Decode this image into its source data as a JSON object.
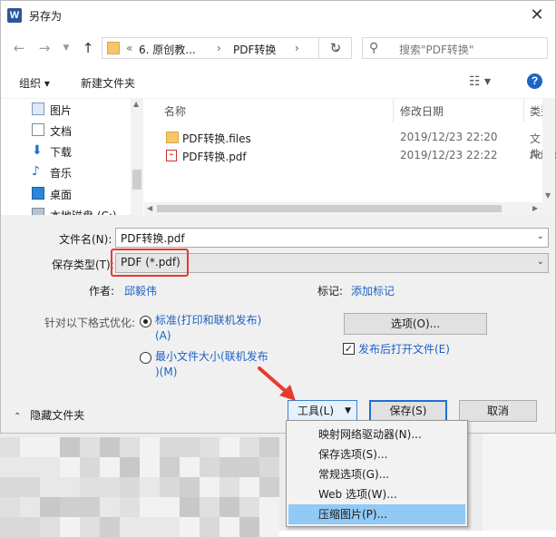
{
  "window": {
    "title": "另存为",
    "app_icon": "W"
  },
  "nav": {
    "breadcrumb": [
      "«",
      "6. 原创教...",
      "›",
      "PDF转换",
      "›"
    ],
    "search_placeholder": "搜索\"PDF转换\""
  },
  "toolbar": {
    "organize": "组织 ▾",
    "new_folder": "新建文件夹"
  },
  "sidebar": {
    "items": [
      {
        "label": "图片",
        "icon": "pictures-icon"
      },
      {
        "label": "文档",
        "icon": "documents-icon"
      },
      {
        "label": "下载",
        "icon": "download-icon"
      },
      {
        "label": "音乐",
        "icon": "music-icon"
      },
      {
        "label": "桌面",
        "icon": "desktop-icon"
      },
      {
        "label": "本地磁盘 (C:)",
        "icon": "drive-icon"
      }
    ]
  },
  "filelist": {
    "columns": [
      "名称",
      "修改日期",
      "类型"
    ],
    "rows": [
      {
        "name": "PDF转换.files",
        "date": "2019/12/23 22:20",
        "type": "文件",
        "icon": "folder-icon"
      },
      {
        "name": "PDF转换.pdf",
        "date": "2019/12/23 22:22",
        "type": "Adob",
        "icon": "pdf-file-icon"
      }
    ]
  },
  "form": {
    "filename_label": "文件名(N):",
    "filename_value": "PDF转换.pdf",
    "filetype_label": "保存类型(T):",
    "filetype_value": "PDF (*.pdf)",
    "author_label": "作者:",
    "author_value": "邱毅伟",
    "tags_label": "标记:",
    "tags_value": "添加标记",
    "optimize_label": "针对以下格式优化:",
    "opt_standard_line1": "标准(打印和联机发布)",
    "opt_standard_line2": "(A)",
    "opt_min_line1": "最小文件大小(联机发布",
    "opt_min_line2": ")(M)",
    "options_button": "选项(O)...",
    "open_after_label": "发布后打开文件(E)",
    "open_after_checked": true
  },
  "footer": {
    "hide_folders": "隐藏文件夹",
    "tools_button": "工具(L)",
    "save_button": "保存(S)",
    "cancel_button": "取消"
  },
  "tools_menu": {
    "items": [
      "映射网络驱动器(N)...",
      "保存选项(S)...",
      "常规选项(G)...",
      "Web 选项(W)...",
      "压缩图片(P)..."
    ],
    "highlighted_index": 4
  },
  "colors": {
    "highlight_annotation": "#e8392d",
    "menu_highlight": "#91c9f7",
    "link": "#1c62c5"
  }
}
